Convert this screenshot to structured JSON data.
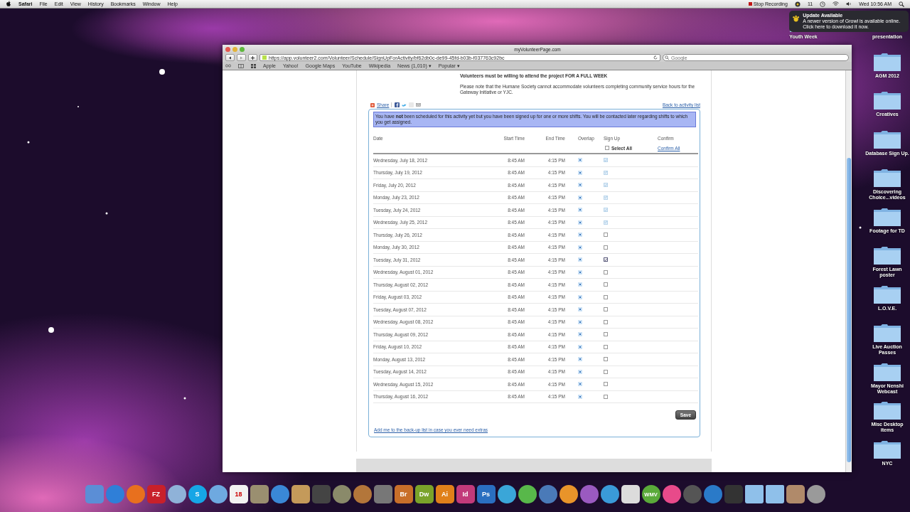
{
  "menubar": {
    "app": "Safari",
    "menus": [
      "File",
      "Edit",
      "View",
      "History",
      "Bookmarks",
      "Window",
      "Help"
    ],
    "recording": "Stop Recording",
    "count": "11",
    "clock": "Wed 10:56 AM"
  },
  "growl": {
    "title": "Update Available",
    "text": "A newer version of Growl is available online. Click here to download it now."
  },
  "desktop_folders_left": [
    {
      "label": "Youth Week",
      "kind": "folder"
    }
  ],
  "desktop_folders_right": [
    {
      "label": "presentation",
      "kind": "label"
    },
    {
      "label": "AGM 2012",
      "kind": "folder"
    },
    {
      "label": "Creatives",
      "kind": "folder"
    },
    {
      "label": "Database Sign Up.",
      "kind": "folder"
    },
    {
      "label": "Discovering Choice...videos",
      "kind": "folder"
    },
    {
      "label": "Footage for TD",
      "kind": "folder"
    },
    {
      "label": "Forest Lawn poster",
      "kind": "folder"
    },
    {
      "label": "L.O.V.E.",
      "kind": "folder"
    },
    {
      "label": "Live Auction Passes",
      "kind": "folder"
    },
    {
      "label": "Mayor Nenshi Webcast",
      "kind": "folder"
    },
    {
      "label": "Misc Desktop items",
      "kind": "folder"
    },
    {
      "label": "NYC",
      "kind": "folder"
    }
  ],
  "window": {
    "title": "myVolunteerPage.com",
    "url": "https://app.volunteer2.com/Volunteer/Schedule/SignUpForActivity/bf62db0c-de99-45fd-b03b-f037763c92bc",
    "search_placeholder": "Google",
    "bookmarks": [
      "Apple",
      "Yahoo!",
      "Google Maps",
      "YouTube",
      "Wikipedia",
      "News (1,010) ▾",
      "Popular ▾"
    ]
  },
  "page": {
    "notes": [
      "Volunteers must be willing to attend the project FOR A FULL WEEK",
      "Please note that the Humane Society cannot accommodate volunteers completing community service hours for the Gateway Initiative or YJC."
    ],
    "share": "Share",
    "back_link": "Back to activity list",
    "notice": "You have **not** been scheduled for this activity yet but you have been signed up for one or more shifts. You will be contacted later regarding shifts to which you get assigned.",
    "columns": [
      "Date",
      "Start Time",
      "End Time",
      "Overlap",
      "Sign Up",
      "Confirm"
    ],
    "select_all": {
      "label": "Select All",
      "checked": false
    },
    "confirm_all": "Confirm All",
    "rows": [
      {
        "date": "Wednesday, July 18, 2012",
        "start": "8:45 AM",
        "end": "4:15 PM",
        "checked": true,
        "disabled": true
      },
      {
        "date": "Thursday, July 19, 2012",
        "start": "8:45 AM",
        "end": "4:15 PM",
        "checked": true,
        "disabled": true
      },
      {
        "date": "Friday, July 20, 2012",
        "start": "8:45 AM",
        "end": "4:15 PM",
        "checked": true,
        "disabled": true
      },
      {
        "date": "Monday, July 23, 2012",
        "start": "8:45 AM",
        "end": "4:15 PM",
        "checked": true,
        "disabled": true
      },
      {
        "date": "Tuesday, July 24, 2012",
        "start": "8:45 AM",
        "end": "4:15 PM",
        "checked": true,
        "disabled": true
      },
      {
        "date": "Wednesday, July 25, 2012",
        "start": "8:45 AM",
        "end": "4:15 PM",
        "checked": true,
        "disabled": true
      },
      {
        "date": "Thursday, July 26, 2012",
        "start": "8:45 AM",
        "end": "4:15 PM",
        "checked": false,
        "disabled": false
      },
      {
        "date": "Monday, July 30, 2012",
        "start": "8:45 AM",
        "end": "4:15 PM",
        "checked": false,
        "disabled": false
      },
      {
        "date": "Tuesday, July 31, 2012",
        "start": "8:45 AM",
        "end": "4:15 PM",
        "checked": true,
        "disabled": false
      },
      {
        "date": "Wednesday, August 01, 2012",
        "start": "8:45 AM",
        "end": "4:15 PM",
        "checked": false,
        "disabled": false
      },
      {
        "date": "Thursday, August 02, 2012",
        "start": "8:45 AM",
        "end": "4:15 PM",
        "checked": false,
        "disabled": false
      },
      {
        "date": "Friday, August 03, 2012",
        "start": "8:45 AM",
        "end": "4:15 PM",
        "checked": false,
        "disabled": false
      },
      {
        "date": "Tuesday, August 07, 2012",
        "start": "8:45 AM",
        "end": "4:15 PM",
        "checked": false,
        "disabled": false
      },
      {
        "date": "Wednesday, August 08, 2012",
        "start": "8:45 AM",
        "end": "4:15 PM",
        "checked": false,
        "disabled": false
      },
      {
        "date": "Thursday, August 09, 2012",
        "start": "8:45 AM",
        "end": "4:15 PM",
        "checked": false,
        "disabled": false
      },
      {
        "date": "Friday, August 10, 2012",
        "start": "8:45 AM",
        "end": "4:15 PM",
        "checked": false,
        "disabled": false
      },
      {
        "date": "Monday, August 13, 2012",
        "start": "8:45 AM",
        "end": "4:15 PM",
        "checked": false,
        "disabled": false
      },
      {
        "date": "Tuesday, August 14, 2012",
        "start": "8:45 AM",
        "end": "4:15 PM",
        "checked": false,
        "disabled": false
      },
      {
        "date": "Wednesday, August 15, 2012",
        "start": "8:45 AM",
        "end": "4:15 PM",
        "checked": false,
        "disabled": false
      },
      {
        "date": "Thursday, August 16, 2012",
        "start": "8:45 AM",
        "end": "4:15 PM",
        "checked": false,
        "disabled": false
      }
    ],
    "save": "Save",
    "backup_link": "Add me to the back-up list in case you ever need extras"
  },
  "dock": [
    {
      "kind": "tile",
      "color": "#5b8ed6"
    },
    {
      "kind": "round",
      "color": "#2f7fd8"
    },
    {
      "kind": "round",
      "color": "#e8701e"
    },
    {
      "kind": "tile",
      "color": "#c8202a",
      "label": "FZ"
    },
    {
      "kind": "round",
      "color": "#8fb2d8"
    },
    {
      "kind": "round",
      "color": "#16a6e6",
      "label": "S"
    },
    {
      "kind": "round",
      "color": "#6ea9e0"
    },
    {
      "kind": "tile",
      "color": "#f2f2f2",
      "label": "18"
    },
    {
      "kind": "tile",
      "color": "#9a8f70"
    },
    {
      "kind": "round",
      "color": "#3a88d6"
    },
    {
      "kind": "tile",
      "color": "#c49a5a"
    },
    {
      "kind": "tile",
      "color": "#444444"
    },
    {
      "kind": "round",
      "color": "#8a8a6a"
    },
    {
      "kind": "round",
      "color": "#b3763a"
    },
    {
      "kind": "tile",
      "color": "#777777"
    },
    {
      "kind": "tile",
      "color": "#c86f2a",
      "label": "Br"
    },
    {
      "kind": "tile",
      "color": "#7aa32a",
      "label": "Dw"
    },
    {
      "kind": "tile",
      "color": "#e0801a",
      "label": "Ai"
    },
    {
      "kind": "tile",
      "color": "#c23a7a",
      "label": "Id"
    },
    {
      "kind": "tile",
      "color": "#2a6fc0",
      "label": "Ps"
    },
    {
      "kind": "round",
      "color": "#3aa6d8"
    },
    {
      "kind": "round",
      "color": "#58b84a"
    },
    {
      "kind": "round",
      "color": "#4a7ab8"
    },
    {
      "kind": "round",
      "color": "#e8942a"
    },
    {
      "kind": "round",
      "color": "#9a5ac0"
    },
    {
      "kind": "round",
      "color": "#3a9ad8"
    },
    {
      "kind": "tile",
      "color": "#dcdcdc"
    },
    {
      "kind": "round",
      "color": "#5aaa3a",
      "label": "WMV"
    },
    {
      "kind": "round",
      "color": "#e84a8a"
    },
    {
      "kind": "round",
      "color": "#555555"
    },
    {
      "kind": "round",
      "color": "#2a7ac8"
    },
    {
      "kind": "tile",
      "color": "#333333"
    },
    {
      "kind": "folder",
      "color": "#8fc0ea"
    },
    {
      "kind": "folder",
      "color": "#8fc0ea"
    },
    {
      "kind": "tile",
      "color": "#b08a6a"
    },
    {
      "kind": "round",
      "color": "#9a9a9a"
    }
  ]
}
